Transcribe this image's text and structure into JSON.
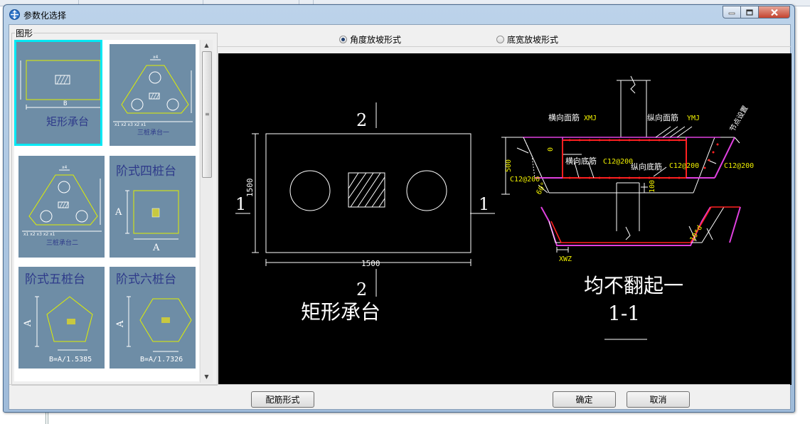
{
  "window": {
    "title": "参数化选择"
  },
  "gallery": {
    "group_label": "图形",
    "items": [
      {
        "label": "矩形承台"
      },
      {
        "label": "三桩承台一"
      },
      {
        "label": "三桩承台二"
      },
      {
        "label": "阶式四桩台"
      },
      {
        "label": "阶式五桩台",
        "formula": "B=A/1.5385"
      },
      {
        "label": "阶式六桩台",
        "formula": "B=A/1.7326"
      }
    ]
  },
  "options": {
    "angle_slope": "角度放坡形式",
    "bottom_width_slope": "底宽放坡形式",
    "selected": "angle_slope"
  },
  "preview": {
    "plan": {
      "title": "矩形承台",
      "width_dim": "1500",
      "height_dim": "1500",
      "sec_num_1": "1",
      "sec_num_2": "2"
    },
    "section": {
      "title": "均不翻起一",
      "subtitle": "1-1",
      "labels": {
        "h_top": "横向面筋",
        "h_top_code": "XMJ",
        "v_top": "纵向面筋",
        "v_top_code": "YMJ",
        "h_bot": "横向底筋",
        "h_bot_val": "C12@200",
        "v_bot": "纵向底筋",
        "v_bot_val": "C12@200",
        "left_val": "C12@200",
        "right_val": "C12@200",
        "side_bar": "节点设置",
        "dim_500": "500",
        "dim_0": "0",
        "dim_100": "100",
        "angle": "60°",
        "xwz": "XWZ",
        "anchor": "10*d"
      }
    }
  },
  "buttons": {
    "rebar_form": "配筋形式",
    "ok": "确定",
    "cancel": "取消"
  },
  "colors": {
    "canvas_bg": "#000000",
    "rebar_red": "#ff2020",
    "stirrup_magenta": "#e040e0",
    "label_yellow": "#f0f000"
  }
}
